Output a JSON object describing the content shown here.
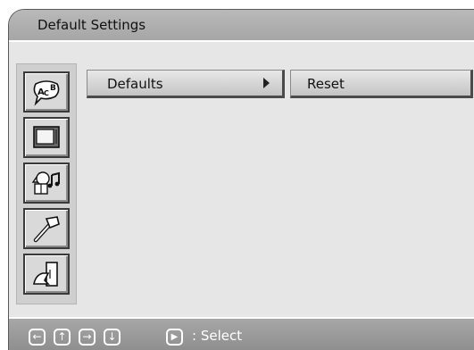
{
  "window": {
    "title": "Default Settings"
  },
  "sidebar": {
    "icons": [
      {
        "name": "language-icon",
        "glyph_text": "ACB"
      },
      {
        "name": "tv-icon"
      },
      {
        "name": "audio-icon"
      },
      {
        "name": "setup-tools-icon"
      },
      {
        "name": "exit-icon"
      }
    ]
  },
  "menu": {
    "primary": {
      "label": "Defaults"
    },
    "secondary": {
      "label": "Reset"
    }
  },
  "footer": {
    "nav": {
      "left": "←",
      "up": "↑",
      "right": "→",
      "down": "↓",
      "play": "▶"
    },
    "select_label": ": Select"
  }
}
